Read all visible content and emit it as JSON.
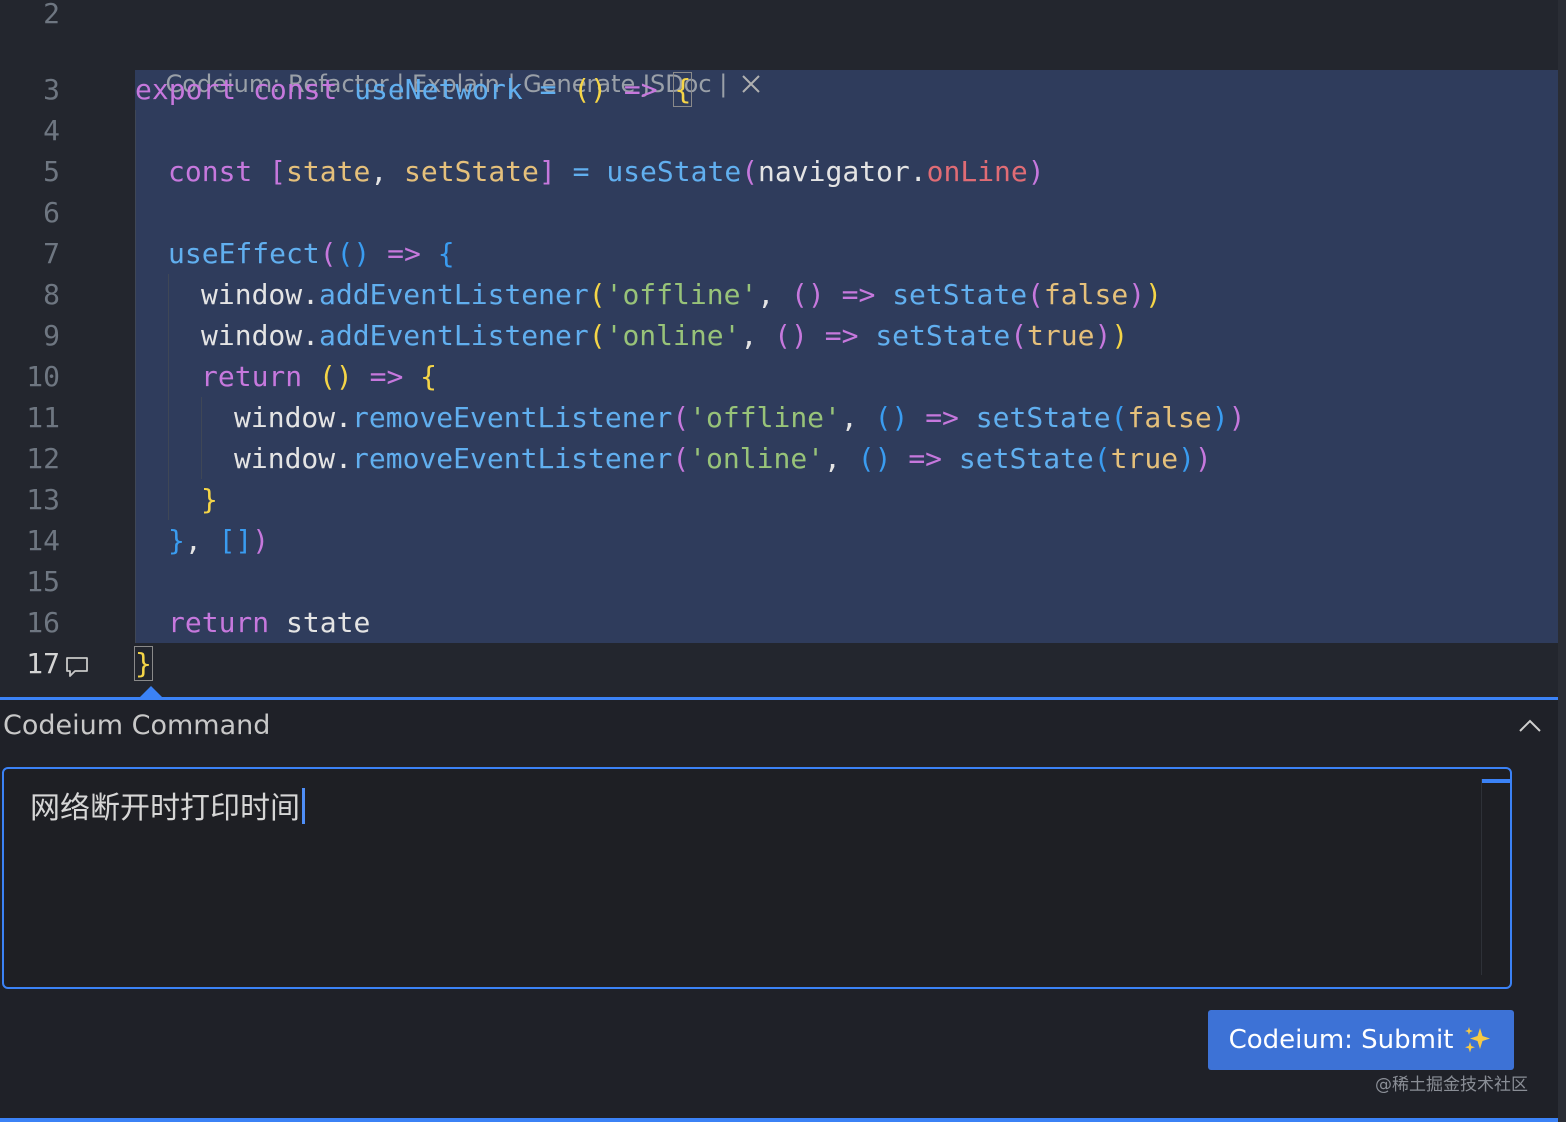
{
  "editor": {
    "codelens": {
      "prefix": "Codeium: ",
      "refactor": "Refactor",
      "explain": "Explain",
      "jsdoc": "Generate JSDoc",
      "separator": " | ",
      "close_icon": "close-icon"
    },
    "line_numbers": [
      "2",
      "3",
      "4",
      "5",
      "6",
      "7",
      "8",
      "9",
      "10",
      "11",
      "12",
      "13",
      "14",
      "15",
      "16",
      "17"
    ],
    "gutter_icon": "comment-icon",
    "code": {
      "l3": [
        "export",
        " ",
        "const",
        " ",
        "useNetwork",
        " ",
        "=",
        " ",
        "()",
        " ",
        "=>",
        " ",
        "{"
      ],
      "l5": [
        "const",
        " ",
        "[",
        "state",
        ",",
        " ",
        "setState",
        "]",
        " ",
        "=",
        " ",
        "useState",
        "(",
        "navigator",
        ".",
        "onLine",
        ")"
      ],
      "l7": [
        "useEffect",
        "(",
        "()",
        " ",
        "=>",
        " ",
        "{"
      ],
      "l8": [
        "window",
        ".",
        "addEventListener",
        "(",
        "'offline'",
        ",",
        " ",
        "()",
        " ",
        "=>",
        " ",
        "setState",
        "(",
        "false",
        ")",
        ")"
      ],
      "l9": [
        "window",
        ".",
        "addEventListener",
        "(",
        "'online'",
        ",",
        " ",
        "()",
        " ",
        "=>",
        " ",
        "setState",
        "(",
        "true",
        ")",
        ")"
      ],
      "l10": [
        "return",
        " ",
        "()",
        " ",
        "=>",
        " ",
        "{"
      ],
      "l11": [
        "window",
        ".",
        "removeEventListener",
        "(",
        "'offline'",
        ",",
        " ",
        "()",
        " ",
        "=>",
        " ",
        "setState",
        "(",
        "false",
        ")",
        ")"
      ],
      "l12": [
        "window",
        ".",
        "removeEventListener",
        "(",
        "'online'",
        ",",
        " ",
        "()",
        " ",
        "=>",
        " ",
        "setState",
        "(",
        "true",
        ")",
        ")"
      ],
      "l13": [
        "}"
      ],
      "l14": [
        "}",
        ",",
        " ",
        "[]",
        ")"
      ],
      "l16": [
        "return",
        " ",
        "state"
      ],
      "l17": [
        "}"
      ]
    }
  },
  "panel": {
    "title": "Codeium Command",
    "collapse_icon": "chevron-up-icon",
    "input_value": "网络断开时打印时间",
    "submit_label": "Codeium: Submit",
    "submit_icon": "sparkles-icon"
  },
  "watermark": "@稀土掘金技术社区",
  "colors": {
    "accent": "#3b82f6",
    "selection": "#2f3c5c",
    "keyword": "#c678dd",
    "function": "#61afef",
    "string": "#98c379",
    "bracket_yellow": "#f5d547"
  }
}
